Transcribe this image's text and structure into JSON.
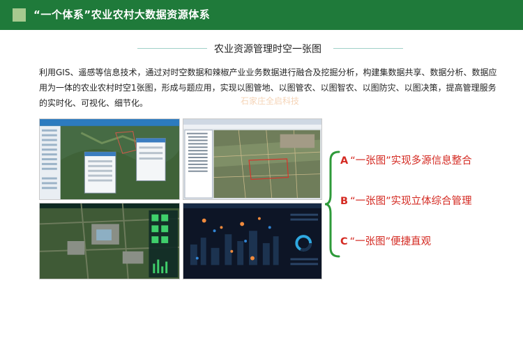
{
  "header": {
    "title": "“一个体系”农业农村大数据资源体系"
  },
  "section": {
    "title": "农业资源管理时空一张图"
  },
  "paragraph": {
    "text": "利用GIS、遥感等信息技术，通过对时空数据和辣椒产业业务数据进行融合及挖掘分析，构建集数据共享、数据分析、数据应用为一体的农业农村时空1张图，形成与题应用，实现以图管地、以图管农、以图智农、以图防灾、以图决策，提高管理服务的实时化、可视化、细节化。"
  },
  "watermark": "石家庄全启科技",
  "features": [
    {
      "letter": "A",
      "text": "“一张图”实现多源信息整合"
    },
    {
      "letter": "B",
      "text": "“一张图”实现立体综合管理"
    },
    {
      "letter": "C",
      "text": "“一张图”便捷直观"
    }
  ],
  "colors": {
    "header_bg": "#1f7a3a",
    "header_square": "#a6c98f",
    "feature_text": "#d42a22",
    "brace": "#2e9a3a",
    "section_line": "#9fd0c7"
  }
}
